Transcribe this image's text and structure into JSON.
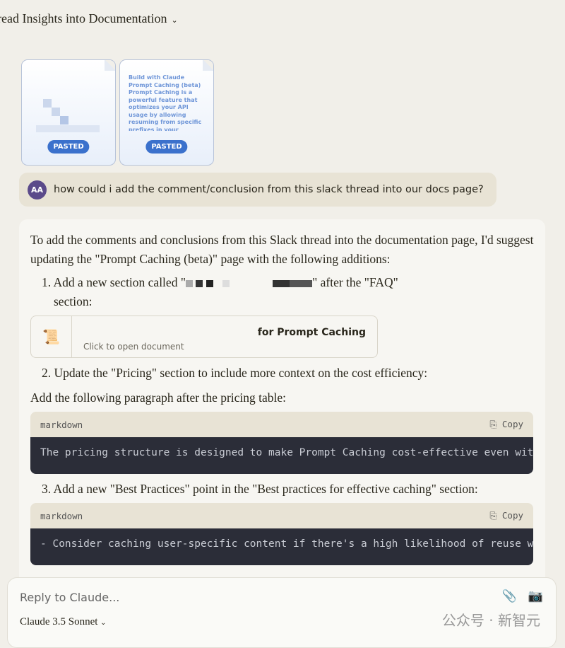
{
  "header": {
    "title": "read Insights into Documentation"
  },
  "attachments": [
    {
      "badge": "PASTED",
      "preview": ""
    },
    {
      "badge": "PASTED",
      "preview": "Build with Claude Prompt Caching (beta) Prompt Caching is a powerful feature that optimizes your API usage by allowing resuming from specific prefixes in your prompts. This approach significantly"
    }
  ],
  "user_message": {
    "initials": "AA",
    "text": "how could i add the comment/conclusion from this slack thread into our docs page?"
  },
  "response": {
    "intro": "To add the comments and conclusions from this Slack thread into the documentation page, I'd suggest updating the \"Prompt Caching (beta)\" page with the following additions:",
    "step1_a": "1. Add a new section called \"",
    "step1_b": "\" after the \"FAQ\"",
    "step1_c": "section:",
    "doc_card": {
      "title": "for Prompt Caching",
      "subtitle": "Click to open document"
    },
    "step2": "2. Update the \"Pricing\" section to include more context on the cost efficiency:",
    "para": "Add the following paragraph after the pricing table:",
    "code1": {
      "lang": "markdown",
      "copy": "Copy",
      "text": "The pricing structure is designed to make Prompt Caching cost-effective even with p"
    },
    "step3": "3. Add a new \"Best Practices\" point in the \"Best practices for effective caching\" section:",
    "code2": {
      "lang": "markdown",
      "copy": "Copy",
      "text": "- Consider caching user-specific content if there's a high likelihood of reuse with"
    }
  },
  "composer": {
    "placeholder": "Reply to Claude...",
    "model": "Claude 3.5 Sonnet"
  },
  "watermark": "公众号 · 新智元"
}
